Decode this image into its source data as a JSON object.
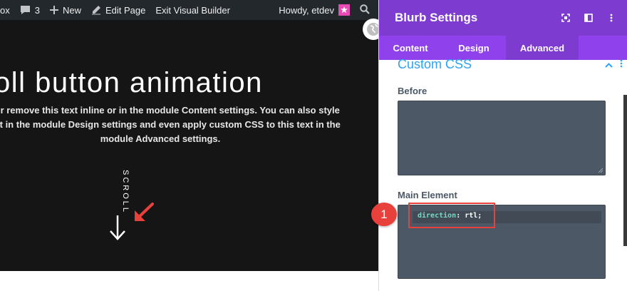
{
  "adminbar": {
    "fragment": "ox",
    "comments_count": "3",
    "new_label": "New",
    "edit_page_label": "Edit Page",
    "exit_builder_label": "Exit Visual Builder",
    "greeting": "Howdy, etdev"
  },
  "hero": {
    "title": "oll button animation",
    "body_line1": "dit or remove this text inline or in the module Content settings. You can also style",
    "body_line2": "ntent in the module Design settings and even apply custom CSS to this text in the",
    "body_line3": "module Advanced settings.",
    "scroll_label": "SCROLL"
  },
  "panel": {
    "title": "Blurb Settings",
    "tabs": [
      {
        "label": "Content"
      },
      {
        "label": "Design"
      },
      {
        "label": "Advanced"
      }
    ],
    "active_tab": "Advanced",
    "section_title": "Custom CSS",
    "before_label": "Before",
    "main_element_label": "Main Element",
    "code_property": "direction",
    "code_colon": ":",
    "code_value": " rtl;",
    "badge_number": "1"
  },
  "colors": {
    "panel_header": "#7e3bd0",
    "tabs_bar": "#8f42ec",
    "accent_blue": "#2ea3f2",
    "annotation_red": "#e8413b",
    "textarea_bg": "#4c5866",
    "hero_bg": "#151515",
    "adminbar_bg": "#23282d"
  },
  "icons": {
    "comment": "comment-icon",
    "plus": "plus-icon",
    "pencil": "pencil-icon",
    "search": "search-icon",
    "globe": "globe-icon",
    "fullscreen": "fullscreen-icon",
    "split_view": "split-view-icon",
    "more": "more-vertical-icon",
    "chevron_up": "chevron-up-icon"
  }
}
